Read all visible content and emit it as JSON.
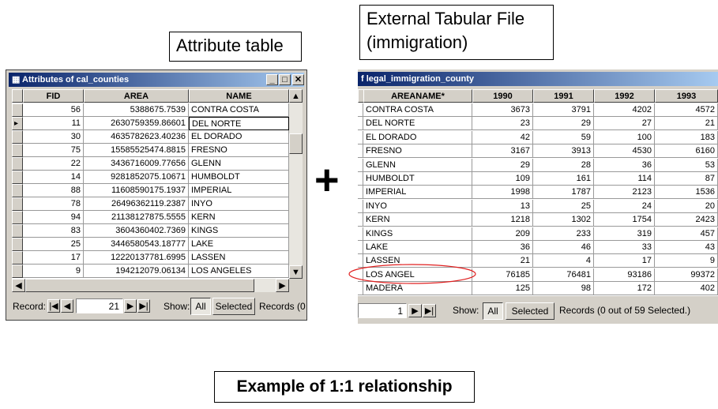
{
  "callouts": {
    "attribute_table": "Attribute table",
    "external_line1": "External Tabular File",
    "external_line2": "(immigration)",
    "plus": "+",
    "caption": "Example of 1:1 relationship"
  },
  "left_window": {
    "title": "Attributes of cal_counties",
    "columns": [
      "FID",
      "AREA",
      "NAME"
    ],
    "rows": [
      [
        "56",
        "5388675.7539",
        "CONTRA COSTA"
      ],
      [
        "11",
        "2630759359.86601",
        "DEL NORTE"
      ],
      [
        "30",
        "4635782623.40236",
        "EL DORADO"
      ],
      [
        "75",
        "15585525474.8815",
        "FRESNO"
      ],
      [
        "22",
        "3436716009.77656",
        "GLENN"
      ],
      [
        "14",
        "9281852075.10671",
        "HUMBOLDT"
      ],
      [
        "88",
        "11608590175.1937",
        "IMPERIAL"
      ],
      [
        "78",
        "26496362119.2387",
        "INYO"
      ],
      [
        "94",
        "21138127875.5555",
        "KERN"
      ],
      [
        "83",
        "3604360402.7369",
        "KINGS"
      ],
      [
        "25",
        "3446580543.18777",
        "LAKE"
      ],
      [
        "17",
        "12220137781.6995",
        "LASSEN"
      ],
      [
        "9",
        "194212079.06134",
        "LOS ANGELES"
      ]
    ],
    "current_row": 1,
    "footer": {
      "record_label": "Record:",
      "record_value": "21",
      "show_label": "Show:",
      "all": "All",
      "selected": "Selected",
      "records": "Records  (0"
    }
  },
  "right_window": {
    "title": "f legal_immigration_county",
    "columns": [
      "AREANAME*",
      "1990",
      "1991",
      "1992",
      "1993"
    ],
    "rows": [
      [
        "CONTRA COSTA",
        "3673",
        "3791",
        "4202",
        "4572"
      ],
      [
        "DEL NORTE",
        "23",
        "29",
        "27",
        "21"
      ],
      [
        "EL DORADO",
        "42",
        "59",
        "100",
        "183"
      ],
      [
        "FRESNO",
        "3167",
        "3913",
        "4530",
        "6160"
      ],
      [
        "GLENN",
        "29",
        "28",
        "36",
        "53"
      ],
      [
        "HUMBOLDT",
        "109",
        "161",
        "114",
        "87"
      ],
      [
        "IMPERIAL",
        "1998",
        "1787",
        "2123",
        "1536"
      ],
      [
        "INYO",
        "13",
        "25",
        "24",
        "20"
      ],
      [
        "KERN",
        "1218",
        "1302",
        "1754",
        "2423"
      ],
      [
        "KINGS",
        "209",
        "233",
        "319",
        "457"
      ],
      [
        "LAKE",
        "36",
        "46",
        "33",
        "43"
      ],
      [
        "LASSEN",
        "21",
        "4",
        "17",
        "9"
      ],
      [
        "LOS ANGEL",
        "76185",
        "76481",
        "93186",
        "99372"
      ],
      [
        "MADERA",
        "125",
        "98",
        "172",
        "402"
      ]
    ],
    "highlighted_row": "LOS ANGEL",
    "highlight_color": "#e02020",
    "footer": {
      "record_value": "1",
      "show_label": "Show:",
      "all": "All",
      "selected": "Selected",
      "records": "Records  (0 out of 59 Selected.)"
    }
  }
}
